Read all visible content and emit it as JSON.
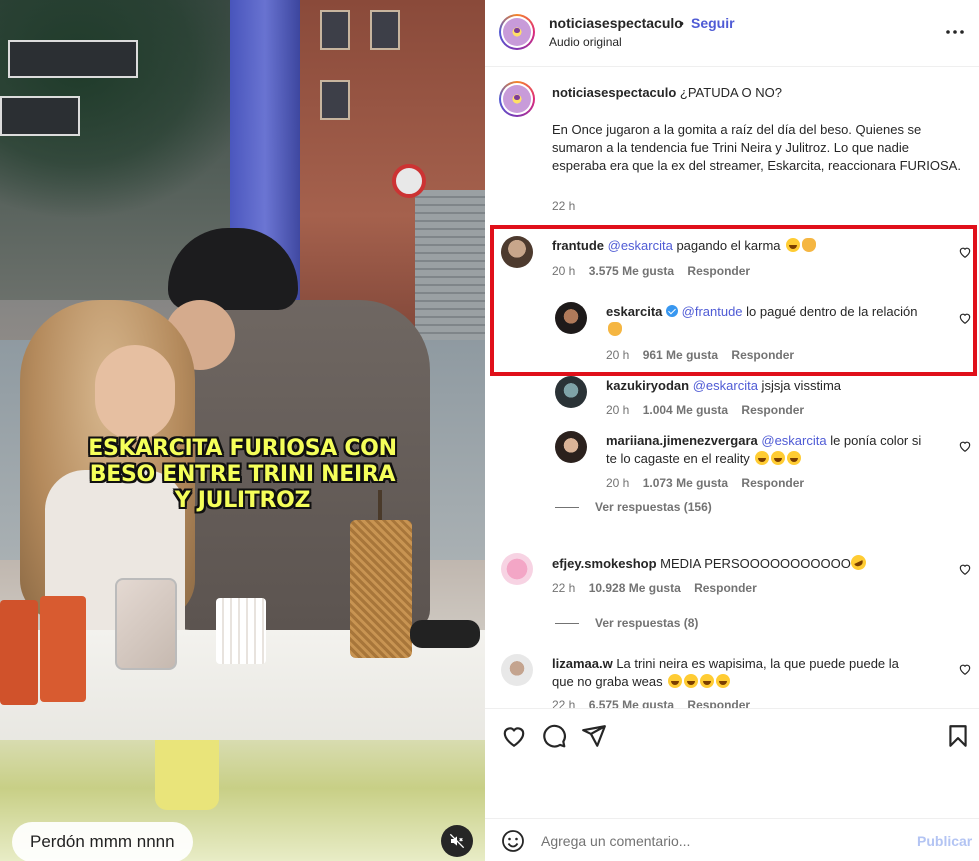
{
  "video": {
    "overlay_caption": [
      "ESKARCITA FURIOSA CON",
      "BESO ENTRE TRINI NEIRA",
      "Y JULITROZ"
    ],
    "subtitle": "Perdón mmm nnnn",
    "mute_icon": "speaker-muted-icon",
    "caption_color": "#f5ff5a"
  },
  "header": {
    "username": "noticiasespectaculo",
    "separator": "•",
    "follow_label": "Seguir",
    "audio_label": "Audio original",
    "more_icon": "more-horizontal-icon"
  },
  "post": {
    "username": "noticiasespectaculo",
    "headline": "¿PATUDA O NO?",
    "body": "En Once jugaron a la gomita a raíz del día del beso. Quienes se sumaron a la tendencia fue Trini Neira y Julitroz. Lo que nadie esperaba era que la ex del streamer, Eskarcita, reaccionara FURIOSA.",
    "time": "22 h"
  },
  "comments": [
    {
      "username": "frantude",
      "mention": "@eskarcita",
      "text": " pagando el karma ",
      "time": "20 h",
      "likes": "3.575 Me gusta",
      "reply_label": "Responder",
      "replies": [
        {
          "username": "eskarcita",
          "verified": true,
          "mention": "@frantude",
          "text": " lo pagué dentro de la relación",
          "time": "20 h",
          "likes": "961 Me gusta",
          "reply_label": "Responder"
        },
        {
          "username": "kazukiryodan",
          "mention": "@eskarcita",
          "text": " jsjsja visstima",
          "time": "20 h",
          "likes": "1.004 Me gusta",
          "reply_label": "Responder"
        },
        {
          "username": "mariiana.jimenezvergara",
          "mention": "@eskarcita",
          "text_line1": " le ponía color si",
          "text_line2": "te lo cagaste en el reality ",
          "time": "20 h",
          "likes": "1.073 Me gusta",
          "reply_label": "Responder"
        }
      ],
      "view_replies": "Ver respuestas (156)"
    },
    {
      "username": "efjey.smokeshop",
      "text": " MEDIA PERSOOOOOOOOOOO",
      "time": "22 h",
      "likes": "10.928 Me gusta",
      "reply_label": "Responder",
      "view_replies": "Ver respuestas (8)"
    },
    {
      "username": "lizamaa.w",
      "text_line1": " La trini neira es wapisima, la que puede puede la",
      "text_line2": "que no graba weas ",
      "time": "22 h",
      "likes": "6.575 Me gusta",
      "reply_label": "Responder"
    }
  ],
  "actions": {
    "like_icon": "heart-icon",
    "comment_icon": "comment-icon",
    "share_icon": "share-icon",
    "save_icon": "bookmark-icon"
  },
  "add_comment": {
    "emoji_icon": "emoji-icon",
    "placeholder": "Agrega un comentario...",
    "publish_label": "Publicar"
  },
  "colors": {
    "highlight_border": "#e0101a",
    "link_blue": "#4f5bd5"
  }
}
